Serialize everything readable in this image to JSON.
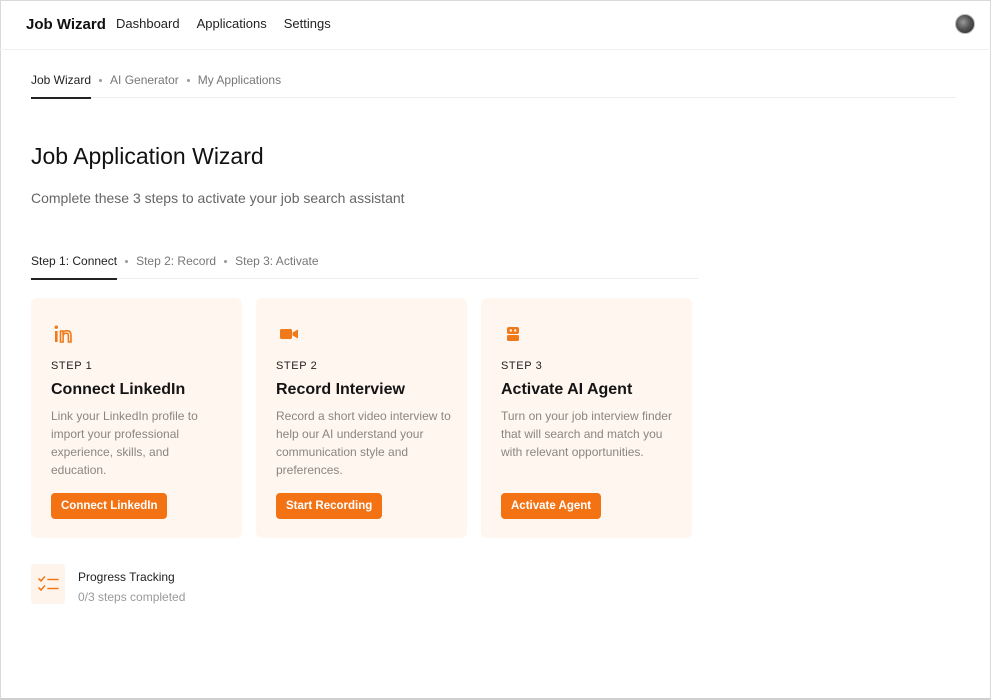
{
  "app": {
    "title": "Job Wizard"
  },
  "nav": {
    "items": [
      "Dashboard",
      "Applications",
      "Settings"
    ]
  },
  "subtabs": {
    "items": [
      "Job Wizard",
      "AI Generator",
      "My Applications"
    ],
    "active": 0
  },
  "page": {
    "title": "Job Application Wizard",
    "subtitle": "Complete these 3 steps to activate your job search assistant"
  },
  "steptabs": {
    "items": [
      "Step 1: Connect",
      "Step 2: Record",
      "Step 3: Activate"
    ],
    "active": 0
  },
  "cards": [
    {
      "step": "STEP 1",
      "title": "Connect LinkedIn",
      "desc": "Link your LinkedIn profile to import your professional experience, skills, and education.",
      "button": "Connect LinkedIn",
      "icon": "linkedin-icon"
    },
    {
      "step": "STEP 2",
      "title": "Record Interview",
      "desc": "Record a short video interview to help our AI understand your communication style and preferences.",
      "button": "Start Recording",
      "icon": "video-camera-icon"
    },
    {
      "step": "STEP 3",
      "title": "Activate AI Agent",
      "desc": "Turn on your job interview finder that will search and match you with relevant opportunities.",
      "button": "Activate Agent",
      "icon": "robot-icon"
    }
  ],
  "progress": {
    "title": "Progress Tracking",
    "status": "0/3 steps completed",
    "icon": "checklist-icon"
  },
  "colors": {
    "accent": "#f27214",
    "card_bg": "#fff6f0"
  }
}
